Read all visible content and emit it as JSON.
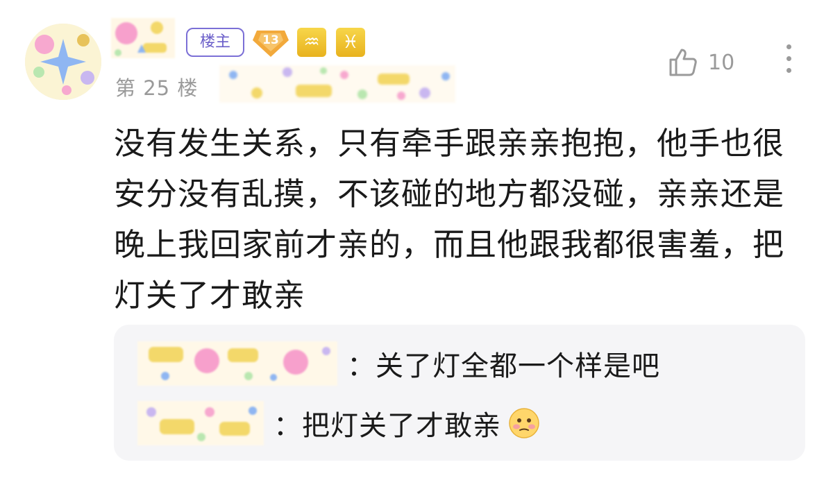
{
  "post": {
    "author_badge": "楼主",
    "level": "13",
    "zodiac_signs": [
      "♒",
      "♓"
    ],
    "floor_label": "第 25 楼",
    "like_count": "10",
    "content": "没有发生关系，只有牵手跟亲亲抱抱，他手也很安分没有乱摸，不该碰的地方都没碰，亲亲还是晚上我回家前才亲的，而且他跟我都很害羞，把灯关了才敢亲"
  },
  "replies": [
    {
      "text": "：关了灯全都一个样是吧",
      "emoji": ""
    },
    {
      "text": "：把灯关了才敢亲",
      "emoji": "flushed-face"
    }
  ],
  "colors": {
    "badge_purple": "#6a5ec9",
    "level_orange": "#f2a93b",
    "zodiac_yellow": "#e8b21e",
    "meta_gray": "#9a9a9a",
    "reply_bg": "#f5f5f7"
  },
  "icons": {
    "like": "thumbs-up-icon",
    "more": "vertical-dots-icon"
  }
}
